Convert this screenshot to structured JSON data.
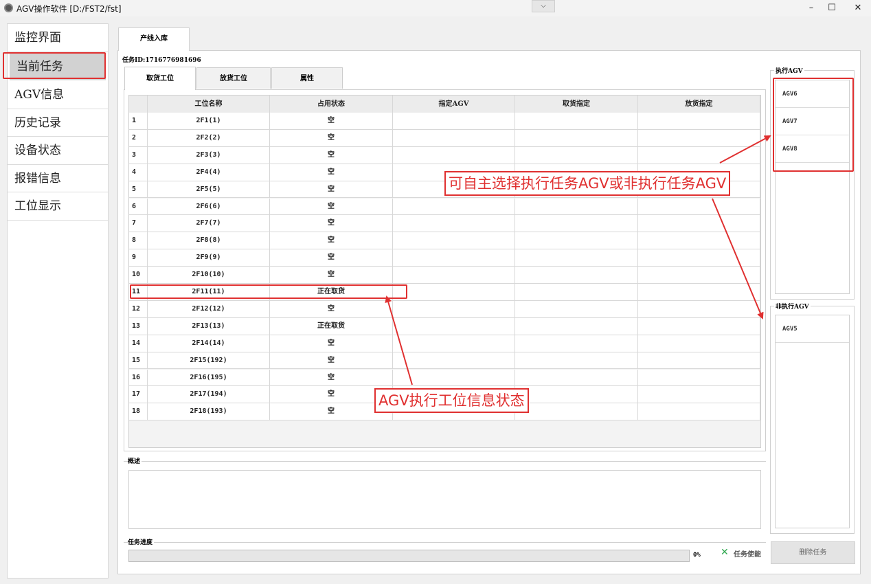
{
  "window": {
    "title": "AGV操作软件 [D:/FST2/fst]",
    "dropdown_glyph": "⌵",
    "minimize": "–",
    "maximize": "☐",
    "close": "✕"
  },
  "nav": {
    "items": [
      {
        "label": "监控界面",
        "active": false
      },
      {
        "label": "当前任务",
        "active": true
      },
      {
        "label": "AGV信息",
        "active": false
      },
      {
        "label": "历史记录",
        "active": false
      },
      {
        "label": "设备状态",
        "active": false
      },
      {
        "label": "报错信息",
        "active": false
      },
      {
        "label": "工位显示",
        "active": false
      }
    ]
  },
  "top_tab": {
    "label": "产线入库"
  },
  "task": {
    "id_label": "任务ID:1716776981696"
  },
  "sub_tabs": [
    {
      "label": "取货工位",
      "active": true
    },
    {
      "label": "放货工位",
      "active": false
    },
    {
      "label": "属性",
      "active": false
    }
  ],
  "table": {
    "headers": [
      "工位名称",
      "占用状态",
      "指定AGV",
      "取货指定",
      "放货指定"
    ],
    "rows": [
      {
        "n": "1",
        "name": "2F1(1)",
        "status": "空"
      },
      {
        "n": "2",
        "name": "2F2(2)",
        "status": "空"
      },
      {
        "n": "3",
        "name": "2F3(3)",
        "status": "空"
      },
      {
        "n": "4",
        "name": "2F4(4)",
        "status": "空"
      },
      {
        "n": "5",
        "name": "2F5(5)",
        "status": "空"
      },
      {
        "n": "6",
        "name": "2F6(6)",
        "status": "空"
      },
      {
        "n": "7",
        "name": "2F7(7)",
        "status": "空"
      },
      {
        "n": "8",
        "name": "2F8(8)",
        "status": "空"
      },
      {
        "n": "9",
        "name": "2F9(9)",
        "status": "空"
      },
      {
        "n": "10",
        "name": "2F10(10)",
        "status": "空"
      },
      {
        "n": "11",
        "name": "2F11(11)",
        "status": "正在取货"
      },
      {
        "n": "12",
        "name": "2F12(12)",
        "status": "空"
      },
      {
        "n": "13",
        "name": "2F13(13)",
        "status": "正在取货"
      },
      {
        "n": "14",
        "name": "2F14(14)",
        "status": "空"
      },
      {
        "n": "15",
        "name": "2F15(192)",
        "status": "空"
      },
      {
        "n": "16",
        "name": "2F16(195)",
        "status": "空"
      },
      {
        "n": "17",
        "name": "2F17(194)",
        "status": "空"
      },
      {
        "n": "18",
        "name": "2F18(193)",
        "status": "空"
      }
    ]
  },
  "description": {
    "label": "概述",
    "value": ""
  },
  "progress": {
    "label": "任务进度",
    "value": 0,
    "text": "0%"
  },
  "task_enable": {
    "label": "任务使能",
    "icon": "✕"
  },
  "delete_button": {
    "label": "删除任务"
  },
  "executing_agv": {
    "title": "执行AGV",
    "items": [
      "AGV6",
      "AGV7",
      "AGV8"
    ]
  },
  "non_executing_agv": {
    "title": "非执行AGV",
    "items": [
      "AGV5"
    ]
  },
  "annotations": {
    "callout_top": "可自主选择执行任务AGV或非执行任务AGV",
    "callout_bottom": "AGV执行工位信息状态",
    "color": "#e03030"
  }
}
